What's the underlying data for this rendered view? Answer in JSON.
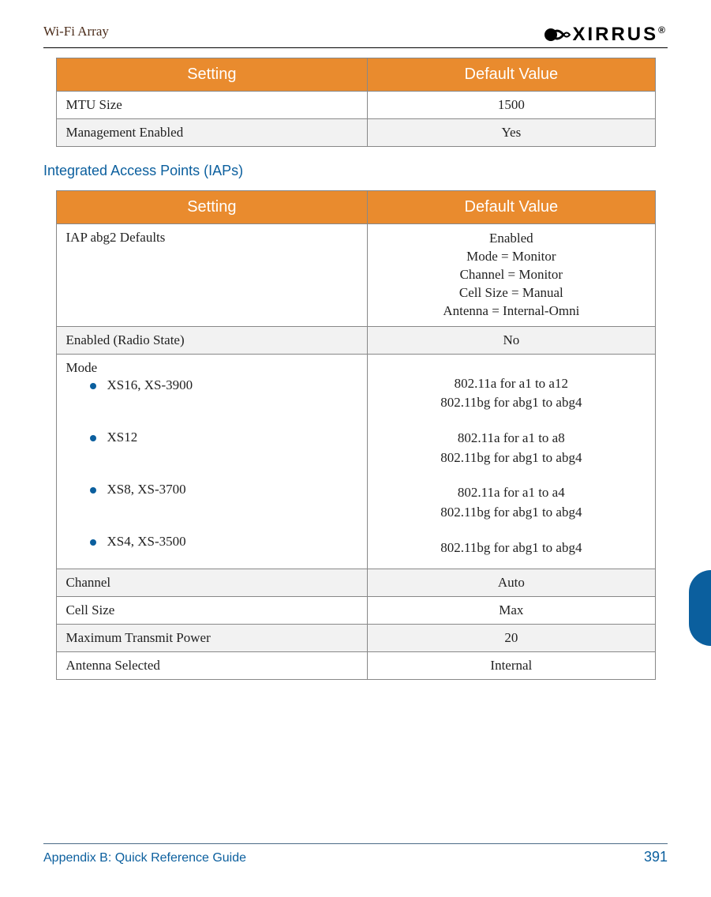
{
  "header": {
    "doc_title": "Wi-Fi Array",
    "logo_text": "XIRRUS",
    "logo_reg": "®"
  },
  "table1": {
    "headers": {
      "c1": "Setting",
      "c2": "Default Value"
    },
    "rows": [
      {
        "setting": "MTU Size",
        "value": "1500"
      },
      {
        "setting": "Management Enabled",
        "value": "Yes"
      }
    ]
  },
  "section_title": "Integrated Access Points (IAPs)",
  "table2": {
    "headers": {
      "c1": "Setting",
      "c2": "Default Value"
    },
    "iap_defaults_label": "IAP abg2 Defaults",
    "iap_defaults_values": {
      "l1": "Enabled",
      "l2": "Mode = Monitor",
      "l3": "Channel = Monitor",
      "l4": "Cell Size = Manual",
      "l5": "Antenna = Internal-Omni"
    },
    "enabled_label": "Enabled (Radio State)",
    "enabled_value": "No",
    "mode_label": "Mode",
    "mode_items": {
      "i1": "XS16, XS-3900",
      "i2": "XS12",
      "i3": "XS8, XS-3700",
      "i4": "XS4, XS-3500"
    },
    "mode_values": {
      "g1l1": "802.11a for a1 to a12",
      "g1l2": "802.11bg for abg1 to abg4",
      "g2l1": "802.11a for a1 to a8",
      "g2l2": "802.11bg for abg1 to abg4",
      "g3l1": "802.11a for a1 to a4",
      "g3l2": "802.11bg for abg1 to abg4",
      "g4l1": "802.11bg for abg1 to abg4"
    },
    "channel_label": "Channel",
    "channel_value": "Auto",
    "cellsize_label": "Cell Size",
    "cellsize_value": "Max",
    "maxtx_label": "Maximum Transmit Power",
    "maxtx_value": "20",
    "antenna_label": "Antenna Selected",
    "antenna_value": "Internal"
  },
  "footer": {
    "left": "Appendix B: Quick Reference Guide",
    "right": "391"
  }
}
